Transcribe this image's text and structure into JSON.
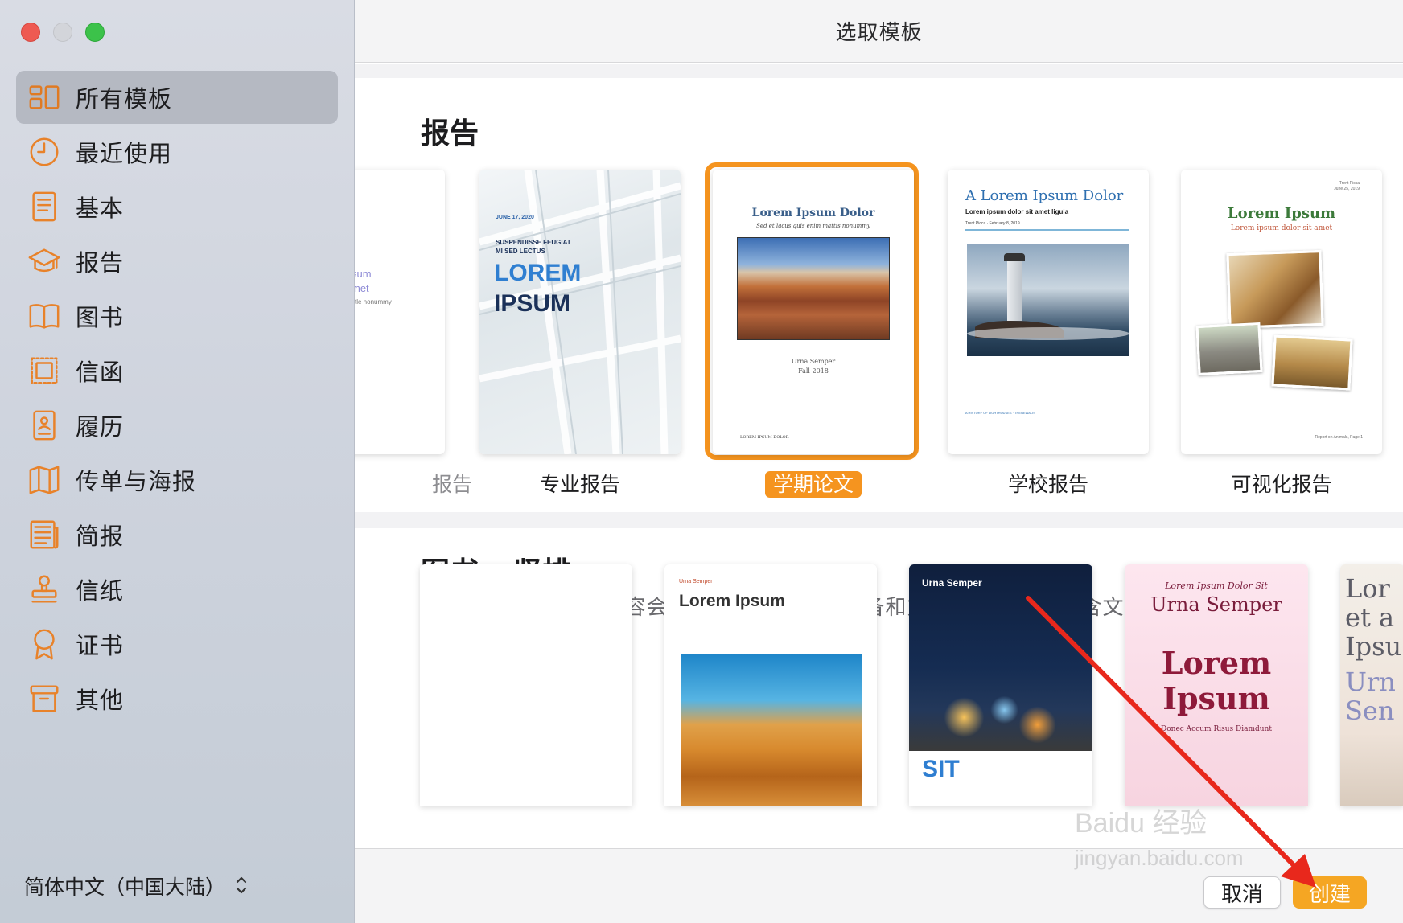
{
  "window": {
    "title": "选取模板"
  },
  "sidebar": {
    "items": [
      {
        "label": "所有模板",
        "icon": "grid-icon",
        "active": true
      },
      {
        "label": "最近使用",
        "icon": "clock-icon",
        "active": false
      },
      {
        "label": "基本",
        "icon": "document-icon",
        "active": false
      },
      {
        "label": "报告",
        "icon": "graduation-cap-icon",
        "active": false
      },
      {
        "label": "图书",
        "icon": "book-icon",
        "active": false
      },
      {
        "label": "信函",
        "icon": "stamp-icon",
        "active": false
      },
      {
        "label": "履历",
        "icon": "person-document-icon",
        "active": false
      },
      {
        "label": "传单与海报",
        "icon": "map-icon",
        "active": false
      },
      {
        "label": "简报",
        "icon": "newsletter-icon",
        "active": false
      },
      {
        "label": "信纸",
        "icon": "rubber-stamp-icon",
        "active": false
      },
      {
        "label": "证书",
        "icon": "ribbon-icon",
        "active": false
      },
      {
        "label": "其他",
        "icon": "archive-box-icon",
        "active": false
      }
    ],
    "language": "简体中文（中国大陆）"
  },
  "sections": [
    {
      "title": "报告",
      "templates": [
        {
          "label": "报告",
          "partial": true,
          "thumb_text": [
            "sum",
            "met",
            "ctle nonummy"
          ]
        },
        {
          "label": "专业报告",
          "thumb_text": [
            "JUNE 17, 2020",
            "SUSPENDISSE FEUGIAT",
            "MI SED LECTUS",
            "LOREM",
            "IPSUM"
          ]
        },
        {
          "label": "学期论文",
          "selected": true,
          "thumb_text": [
            "Lorem Ipsum Dolor",
            "Sed et lacus quis enim mattis nonummy",
            "Urna Semper",
            "Fall 2018",
            "LOREM IPSUM DOLOR"
          ]
        },
        {
          "label": "学校报告",
          "thumb_text": [
            "A Lorem Ipsum Dolor",
            "Lorem ipsum dolor sit amet ligula",
            "Trent Picca · February 8, 2019",
            "A HISTORY OF LIGHTHOUSES · TRENEWALIS"
          ]
        },
        {
          "label": "可视化报告",
          "thumb_text": [
            "Lorem Ipsum",
            "Lorem ipsum dolor sit amet",
            "Trent Picca",
            "June 25, 2019",
            "Report on Animals, Page 1"
          ]
        }
      ]
    },
    {
      "title": "图书 – 竖排",
      "description": "导出为 EPUB 时，内容会重排以适应不同的设备和方向。适合主要包含文本的图书。",
      "templates": [
        {
          "thumb_text": []
        },
        {
          "thumb_text": [
            "Urna Semper",
            "Lorem Ipsum"
          ]
        },
        {
          "thumb_text": [
            "Urna Semper",
            "SIT"
          ]
        },
        {
          "thumb_text": [
            "Lorem Ipsum Dolor Sit",
            "Urna Semper",
            "Lorem",
            "Ipsum",
            "Donec Accum Risus Diamdunt"
          ]
        },
        {
          "thumb_text": [
            "Lor",
            "et a",
            "Ipsu",
            "Urn",
            "Sen"
          ]
        }
      ]
    }
  ],
  "footer": {
    "cancel": "取消",
    "create": "创建"
  },
  "watermark": {
    "line1": "Baidu 经验",
    "line2": "jingyan.baidu.com"
  },
  "colors": {
    "accent": "#f5941f",
    "icon": "#e8822a",
    "create_button": "#f5a623",
    "annotation_arrow": "#e8281c"
  }
}
